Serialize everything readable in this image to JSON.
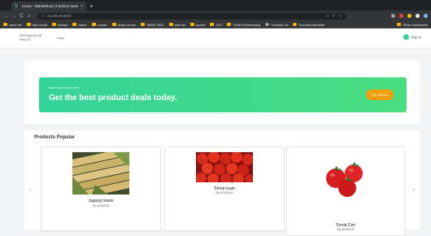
{
  "browser": {
    "tab_title": "Home - Markethunt | Fashion store",
    "tab_close": "×",
    "new_tab": "+",
    "url": "localhost:3000",
    "nav": {
      "back": "←",
      "forward": "→",
      "reload": "C",
      "home": "⌂"
    },
    "bookmarks": [
      "cover art",
      "add moodl",
      "startup",
      "tutors",
      "course",
      "study course",
      "SEMS 2021",
      "android",
      "puzzle",
      "SCF",
      "Tekid Kehimanaing",
      "Tinstock Lib",
      "Documentbroader"
    ],
    "other_bookmarks": "Other bookmarks"
  },
  "site": {
    "logo_text": "HETHAUSCHE PHUCE",
    "nav_link": "Shop",
    "signin_label": "Sign in"
  },
  "hero": {
    "small_text": "Save your coins here",
    "title": "Get the best product deals today.",
    "button_label": "Get Started"
  },
  "products": {
    "heading": "Products Popular",
    "items": [
      {
        "name": "Jagung manis",
        "price": "Rp 14.000,00"
      },
      {
        "name": "Tomat buah",
        "price": "Rp 20.000,00"
      },
      {
        "name": "Tomat Ceri",
        "price": "Rp 18.000,00"
      }
    ]
  },
  "colors": {
    "brand_green": "#34d399",
    "button_orange": "#f59e0b"
  }
}
